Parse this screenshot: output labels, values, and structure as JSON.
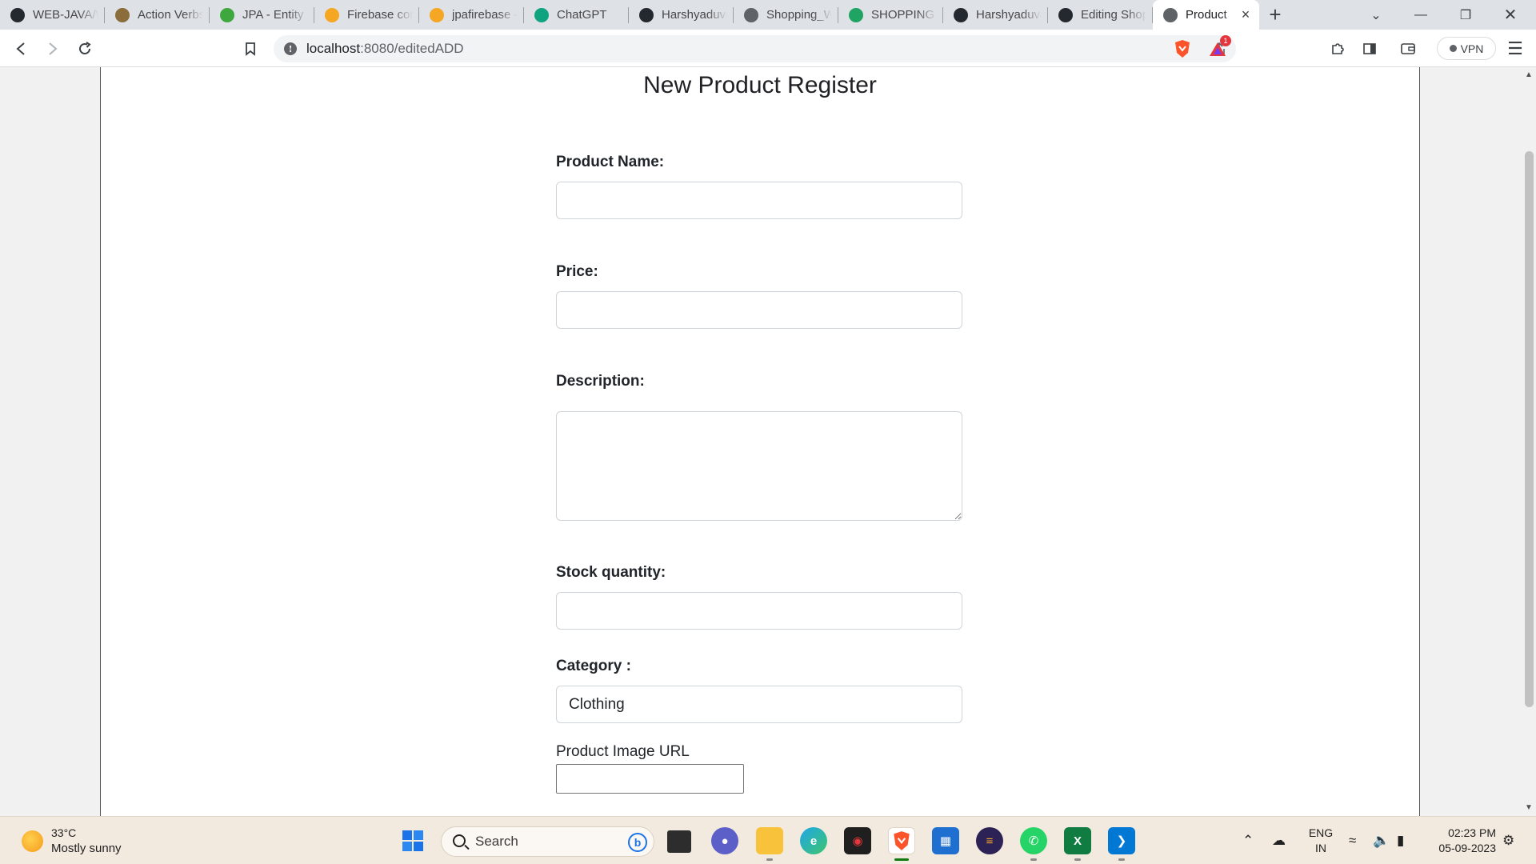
{
  "browser": {
    "tabs": [
      {
        "title": "WEB-JAVA/W",
        "icon": "github-icon",
        "color": "#24292f"
      },
      {
        "title": "Action Verbs",
        "icon": "action-verbs-icon",
        "color": "#8a6d3b"
      },
      {
        "title": "JPA - Entity R",
        "icon": "jpa-icon",
        "color": "#3ea83e"
      },
      {
        "title": "Firebase con",
        "icon": "firebase-icon",
        "color": "#f5a623"
      },
      {
        "title": "jpafirebase -",
        "icon": "firebase-icon",
        "color": "#f5a623"
      },
      {
        "title": "ChatGPT",
        "icon": "chatgpt-icon",
        "color": "#10a37f"
      },
      {
        "title": "Harshyaduva",
        "icon": "github-icon",
        "color": "#24292f"
      },
      {
        "title": "Shopping_W",
        "icon": "globe-icon",
        "color": "#5f6368"
      },
      {
        "title": "SHOPPING A",
        "icon": "google-drive-icon",
        "color": "#1fa463"
      },
      {
        "title": "Harshyaduva",
        "icon": "github-icon",
        "color": "#24292f"
      },
      {
        "title": "Editing Shop",
        "icon": "github-icon",
        "color": "#24292f"
      },
      {
        "title": "Product",
        "icon": "globe-icon",
        "color": "#5f6368",
        "active": true
      }
    ],
    "url_host": "localhost",
    "url_path": ":8080/editedADD",
    "vpn_label": "VPN",
    "rewards_badge": "1"
  },
  "form": {
    "title": "New Product Register",
    "product_name_label": "Product Name:",
    "product_name_value": "",
    "price_label": "Price:",
    "price_value": "",
    "description_label": "Description:",
    "description_value": "",
    "stock_label": "Stock quantity:",
    "stock_value": "",
    "category_label": "Category :",
    "category_selected": "Clothing",
    "image_url_label": "Product Image URL",
    "image_url_value": ""
  },
  "taskbar": {
    "weather_temp": "33°C",
    "weather_desc": "Mostly sunny",
    "search_placeholder": "Search",
    "lang_top": "ENG",
    "lang_bottom": "IN",
    "time": "02:23 PM",
    "date": "05-09-2023"
  },
  "colors": {
    "tabbar_bg": "#dee1e6",
    "taskbar_bg": "#f3eadf",
    "brave_orange": "#fb542b",
    "form_border": "#ced4da"
  }
}
